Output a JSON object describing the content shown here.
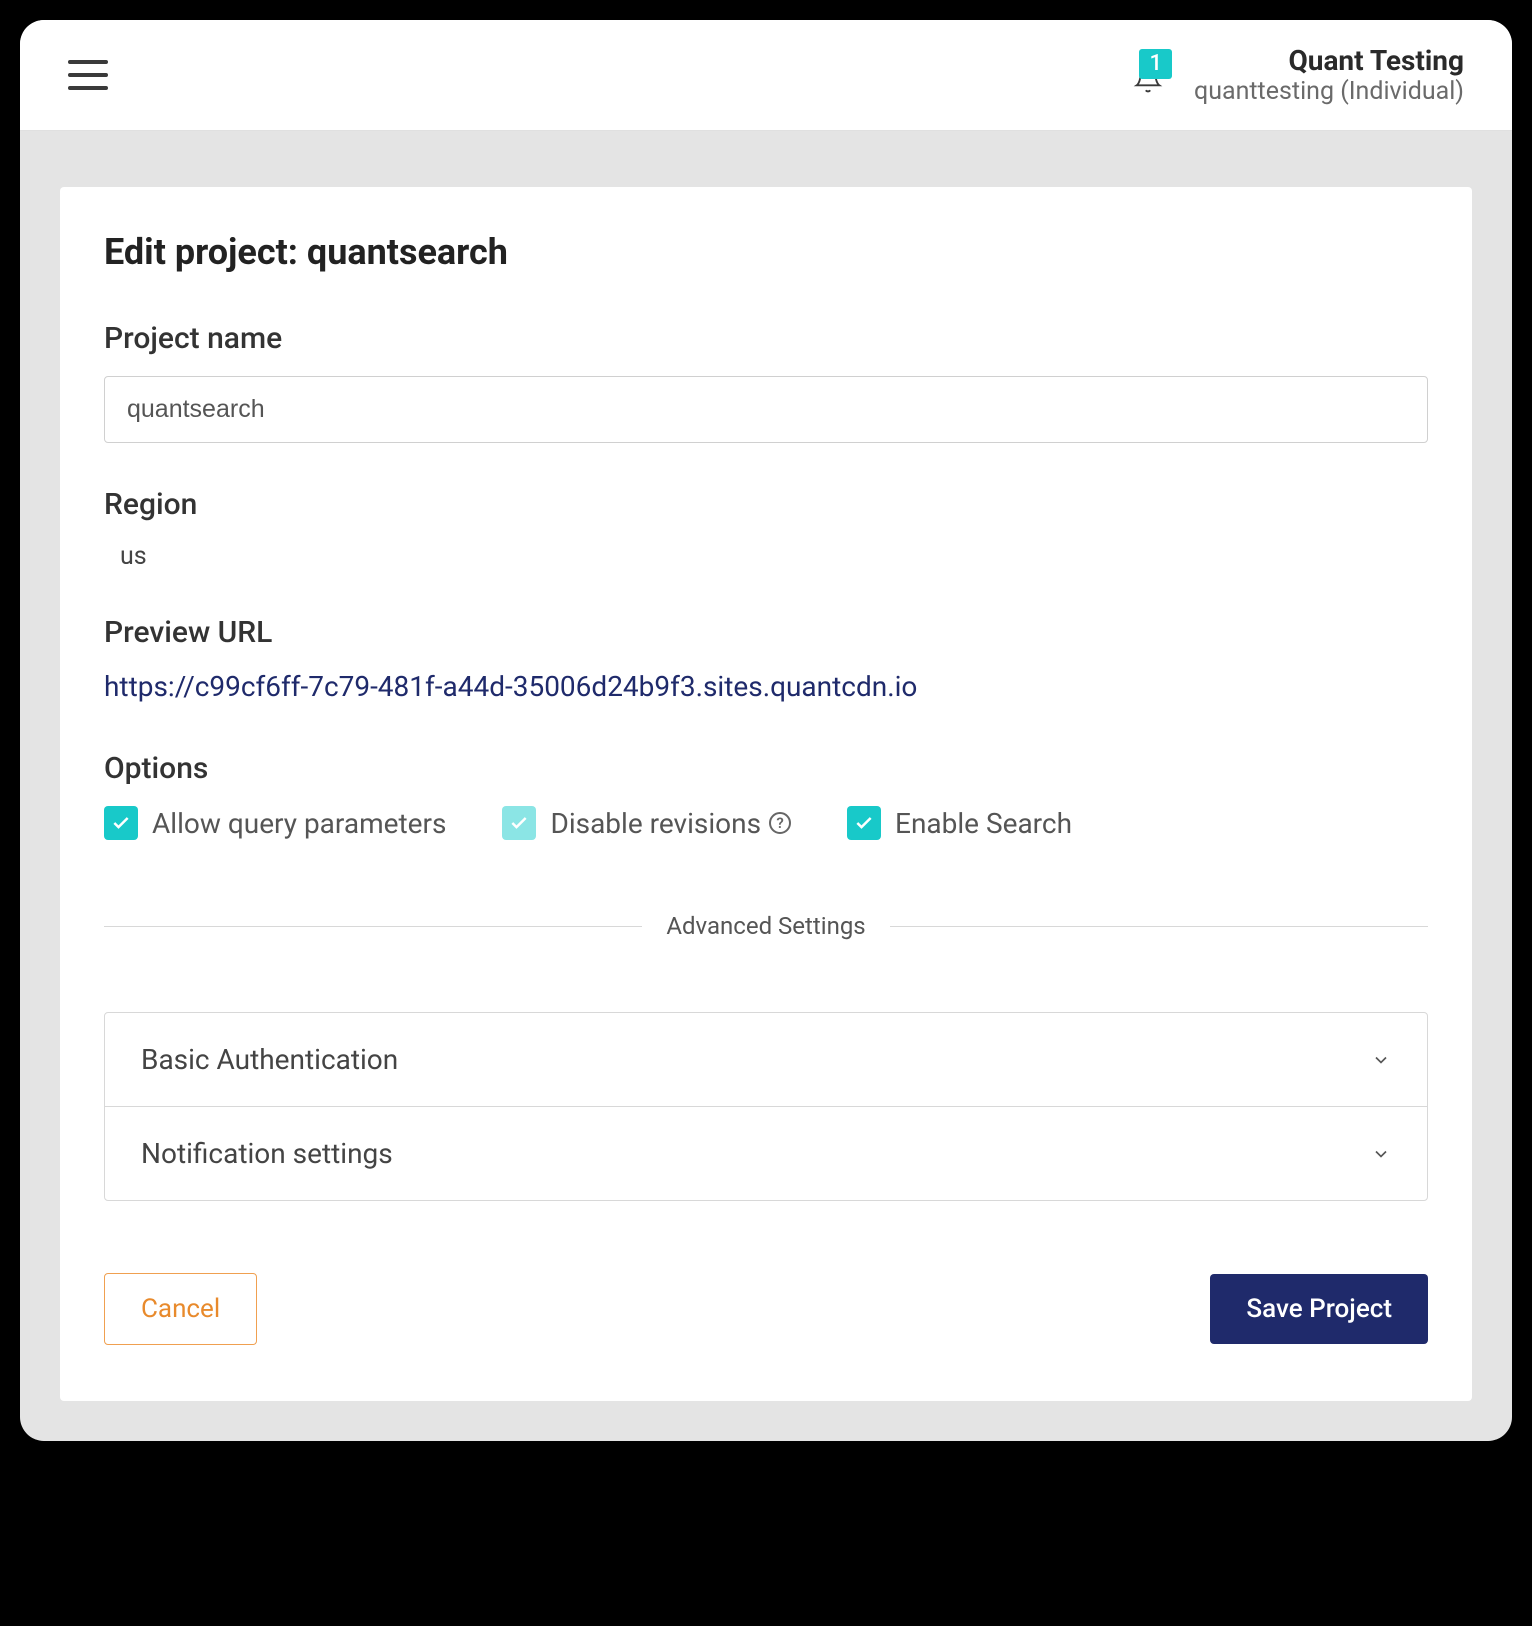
{
  "header": {
    "notification_count": "1",
    "user_name": "Quant Testing",
    "user_sub": "quanttesting (Individual)"
  },
  "page": {
    "title": "Edit project: quantsearch",
    "labels": {
      "project_name": "Project name",
      "region": "Region",
      "preview_url": "Preview URL",
      "options": "Options",
      "advanced": "Advanced Settings"
    },
    "values": {
      "project_name": "quantsearch",
      "region": "us",
      "preview_url": "https://c99cf6ff-7c79-481f-a44d-35006d24b9f3.sites.quantcdn.io"
    },
    "options": {
      "allow_query": "Allow query parameters",
      "disable_revisions": "Disable revisions",
      "enable_search": "Enable Search"
    },
    "accordion": {
      "basic_auth": "Basic Authentication",
      "notification": "Notification settings"
    },
    "buttons": {
      "cancel": "Cancel",
      "save": "Save Project"
    }
  }
}
